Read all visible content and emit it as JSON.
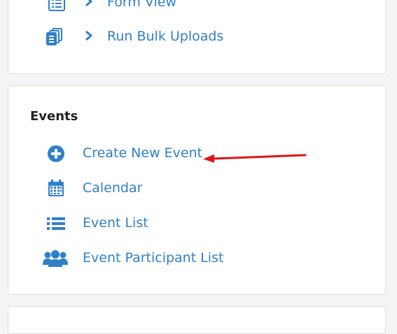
{
  "top_section": {
    "items": [
      {
        "label": "Form View",
        "icon": "list-icon"
      },
      {
        "label": "Run Bulk Uploads",
        "icon": "stacked-files-icon"
      }
    ]
  },
  "events": {
    "title": "Events",
    "items": [
      {
        "label": "Create New Event",
        "icon": "plus-circle-icon"
      },
      {
        "label": "Calendar",
        "icon": "calendar-icon"
      },
      {
        "label": "Event List",
        "icon": "list-icon"
      },
      {
        "label": "Event Participant List",
        "icon": "users-icon"
      }
    ]
  },
  "colors": {
    "link": "#2f80c9",
    "icon": "#2f80c9",
    "annotation_arrow": "#e01414",
    "title": "#1f2328"
  }
}
